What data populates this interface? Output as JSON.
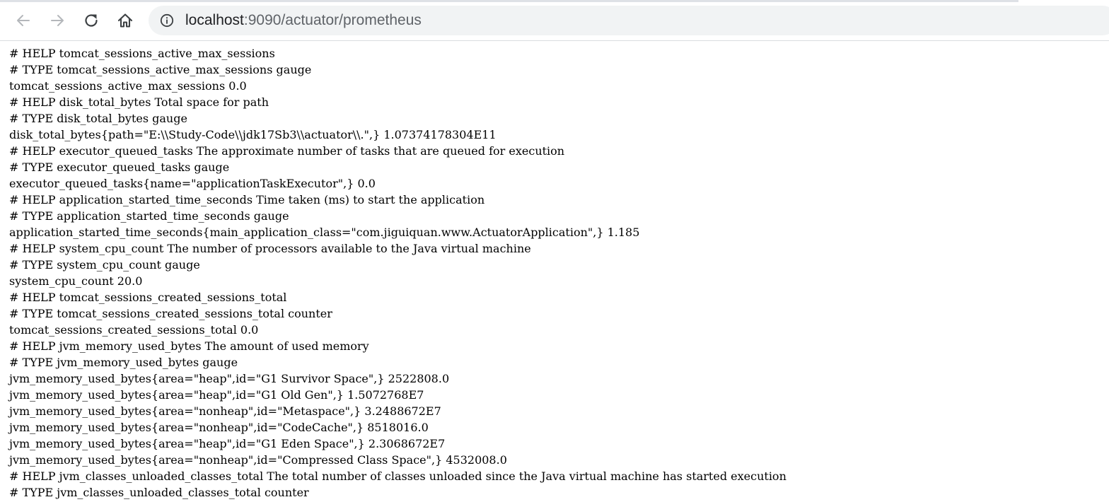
{
  "browser": {
    "url_host": "localhost",
    "url_rest": ":9090/actuator/prometheus"
  },
  "metrics_lines": [
    "# HELP tomcat_sessions_active_max_sessions",
    "# TYPE tomcat_sessions_active_max_sessions gauge",
    "tomcat_sessions_active_max_sessions 0.0",
    "# HELP disk_total_bytes Total space for path",
    "# TYPE disk_total_bytes gauge",
    "disk_total_bytes{path=\"E:\\\\Study-Code\\\\jdk17Sb3\\\\actuator\\\\.\",} 1.07374178304E11",
    "# HELP executor_queued_tasks The approximate number of tasks that are queued for execution",
    "# TYPE executor_queued_tasks gauge",
    "executor_queued_tasks{name=\"applicationTaskExecutor\",} 0.0",
    "# HELP application_started_time_seconds Time taken (ms) to start the application",
    "# TYPE application_started_time_seconds gauge",
    "application_started_time_seconds{main_application_class=\"com.jiguiquan.www.ActuatorApplication\",} 1.185",
    "# HELP system_cpu_count The number of processors available to the Java virtual machine",
    "# TYPE system_cpu_count gauge",
    "system_cpu_count 20.0",
    "# HELP tomcat_sessions_created_sessions_total",
    "# TYPE tomcat_sessions_created_sessions_total counter",
    "tomcat_sessions_created_sessions_total 0.0",
    "# HELP jvm_memory_used_bytes The amount of used memory",
    "# TYPE jvm_memory_used_bytes gauge",
    "jvm_memory_used_bytes{area=\"heap\",id=\"G1 Survivor Space\",} 2522808.0",
    "jvm_memory_used_bytes{area=\"heap\",id=\"G1 Old Gen\",} 1.5072768E7",
    "jvm_memory_used_bytes{area=\"nonheap\",id=\"Metaspace\",} 3.2488672E7",
    "jvm_memory_used_bytes{area=\"nonheap\",id=\"CodeCache\",} 8518016.0",
    "jvm_memory_used_bytes{area=\"heap\",id=\"G1 Eden Space\",} 2.3068672E7",
    "jvm_memory_used_bytes{area=\"nonheap\",id=\"Compressed Class Space\",} 4532008.0",
    "# HELP jvm_classes_unloaded_classes_total The total number of classes unloaded since the Java virtual machine has started execution",
    "# TYPE jvm_classes_unloaded_classes_total counter"
  ]
}
